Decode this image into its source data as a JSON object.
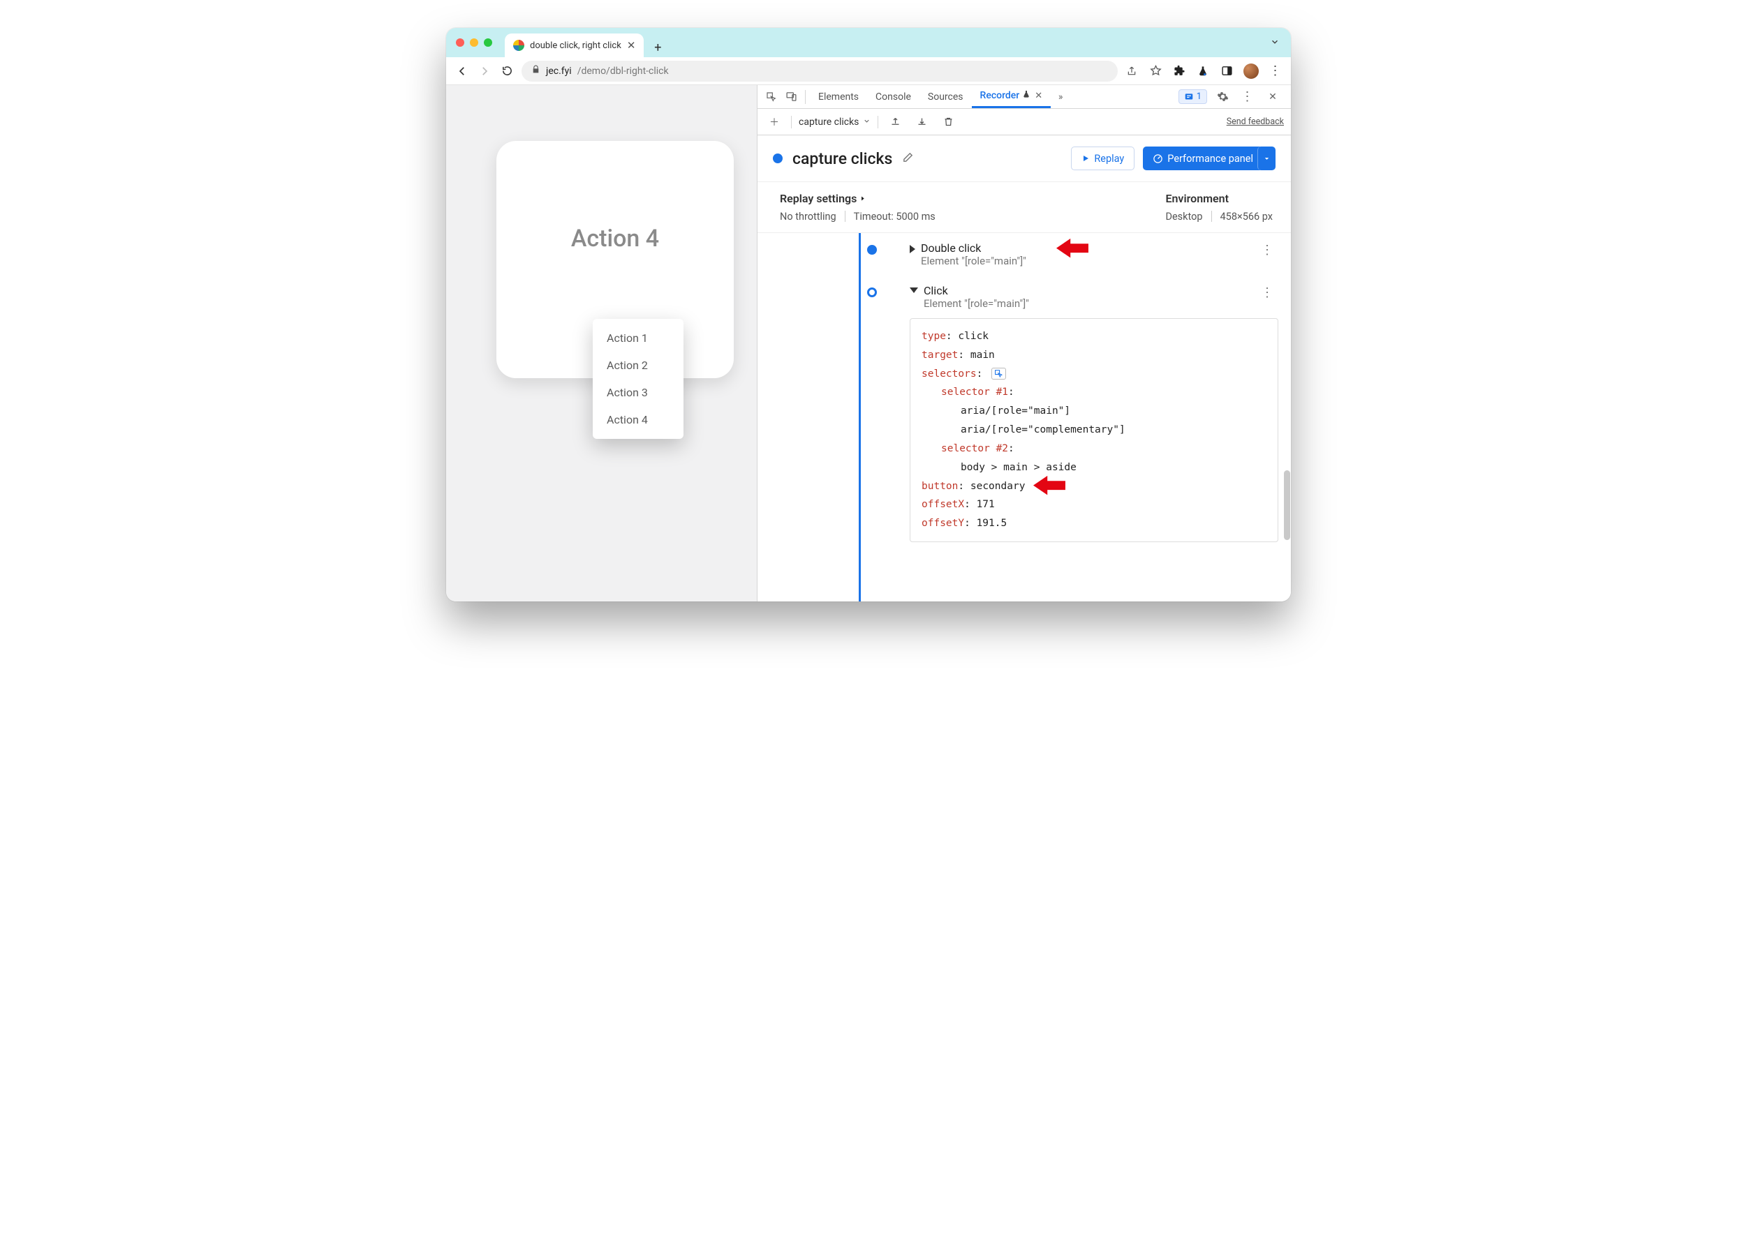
{
  "browser": {
    "tab_title": "double click, right click",
    "url_host": "jec.fyi",
    "url_path": "/demo/dbl-right-click"
  },
  "page": {
    "card_title": "Action 4",
    "menu_items": [
      "Action 1",
      "Action 2",
      "Action 3",
      "Action 4"
    ]
  },
  "devtools": {
    "tabs": [
      "Elements",
      "Console",
      "Sources"
    ],
    "active_tab": "Recorder",
    "flask": "🧪",
    "issues_count": "1",
    "feedback": "Send feedback",
    "recording_name": "capture clicks",
    "replay_btn": "Replay",
    "perf_btn": "Performance panel",
    "settings": {
      "title": "Replay settings",
      "throttling": "No throttling",
      "timeout": "Timeout: 5000 ms",
      "env_title": "Environment",
      "device": "Desktop",
      "viewport": "458×566 px"
    },
    "steps": [
      {
        "title": "Double click",
        "subtitle": "Element \"[role=\"main\"]\"",
        "expanded": false
      },
      {
        "title": "Click",
        "subtitle": "Element \"[role=\"main\"]\"",
        "expanded": true,
        "details": {
          "type": "click",
          "target": "main",
          "selectors_label": "selectors",
          "sel1_label": "selector #1",
          "sel1_a": "aria/[role=\"main\"]",
          "sel1_b": "aria/[role=\"complementary\"]",
          "sel2_label": "selector #2",
          "sel2_a": "body > main > aside",
          "button": "secondary",
          "offsetX": "171",
          "offsetY": "191.5"
        }
      }
    ]
  }
}
